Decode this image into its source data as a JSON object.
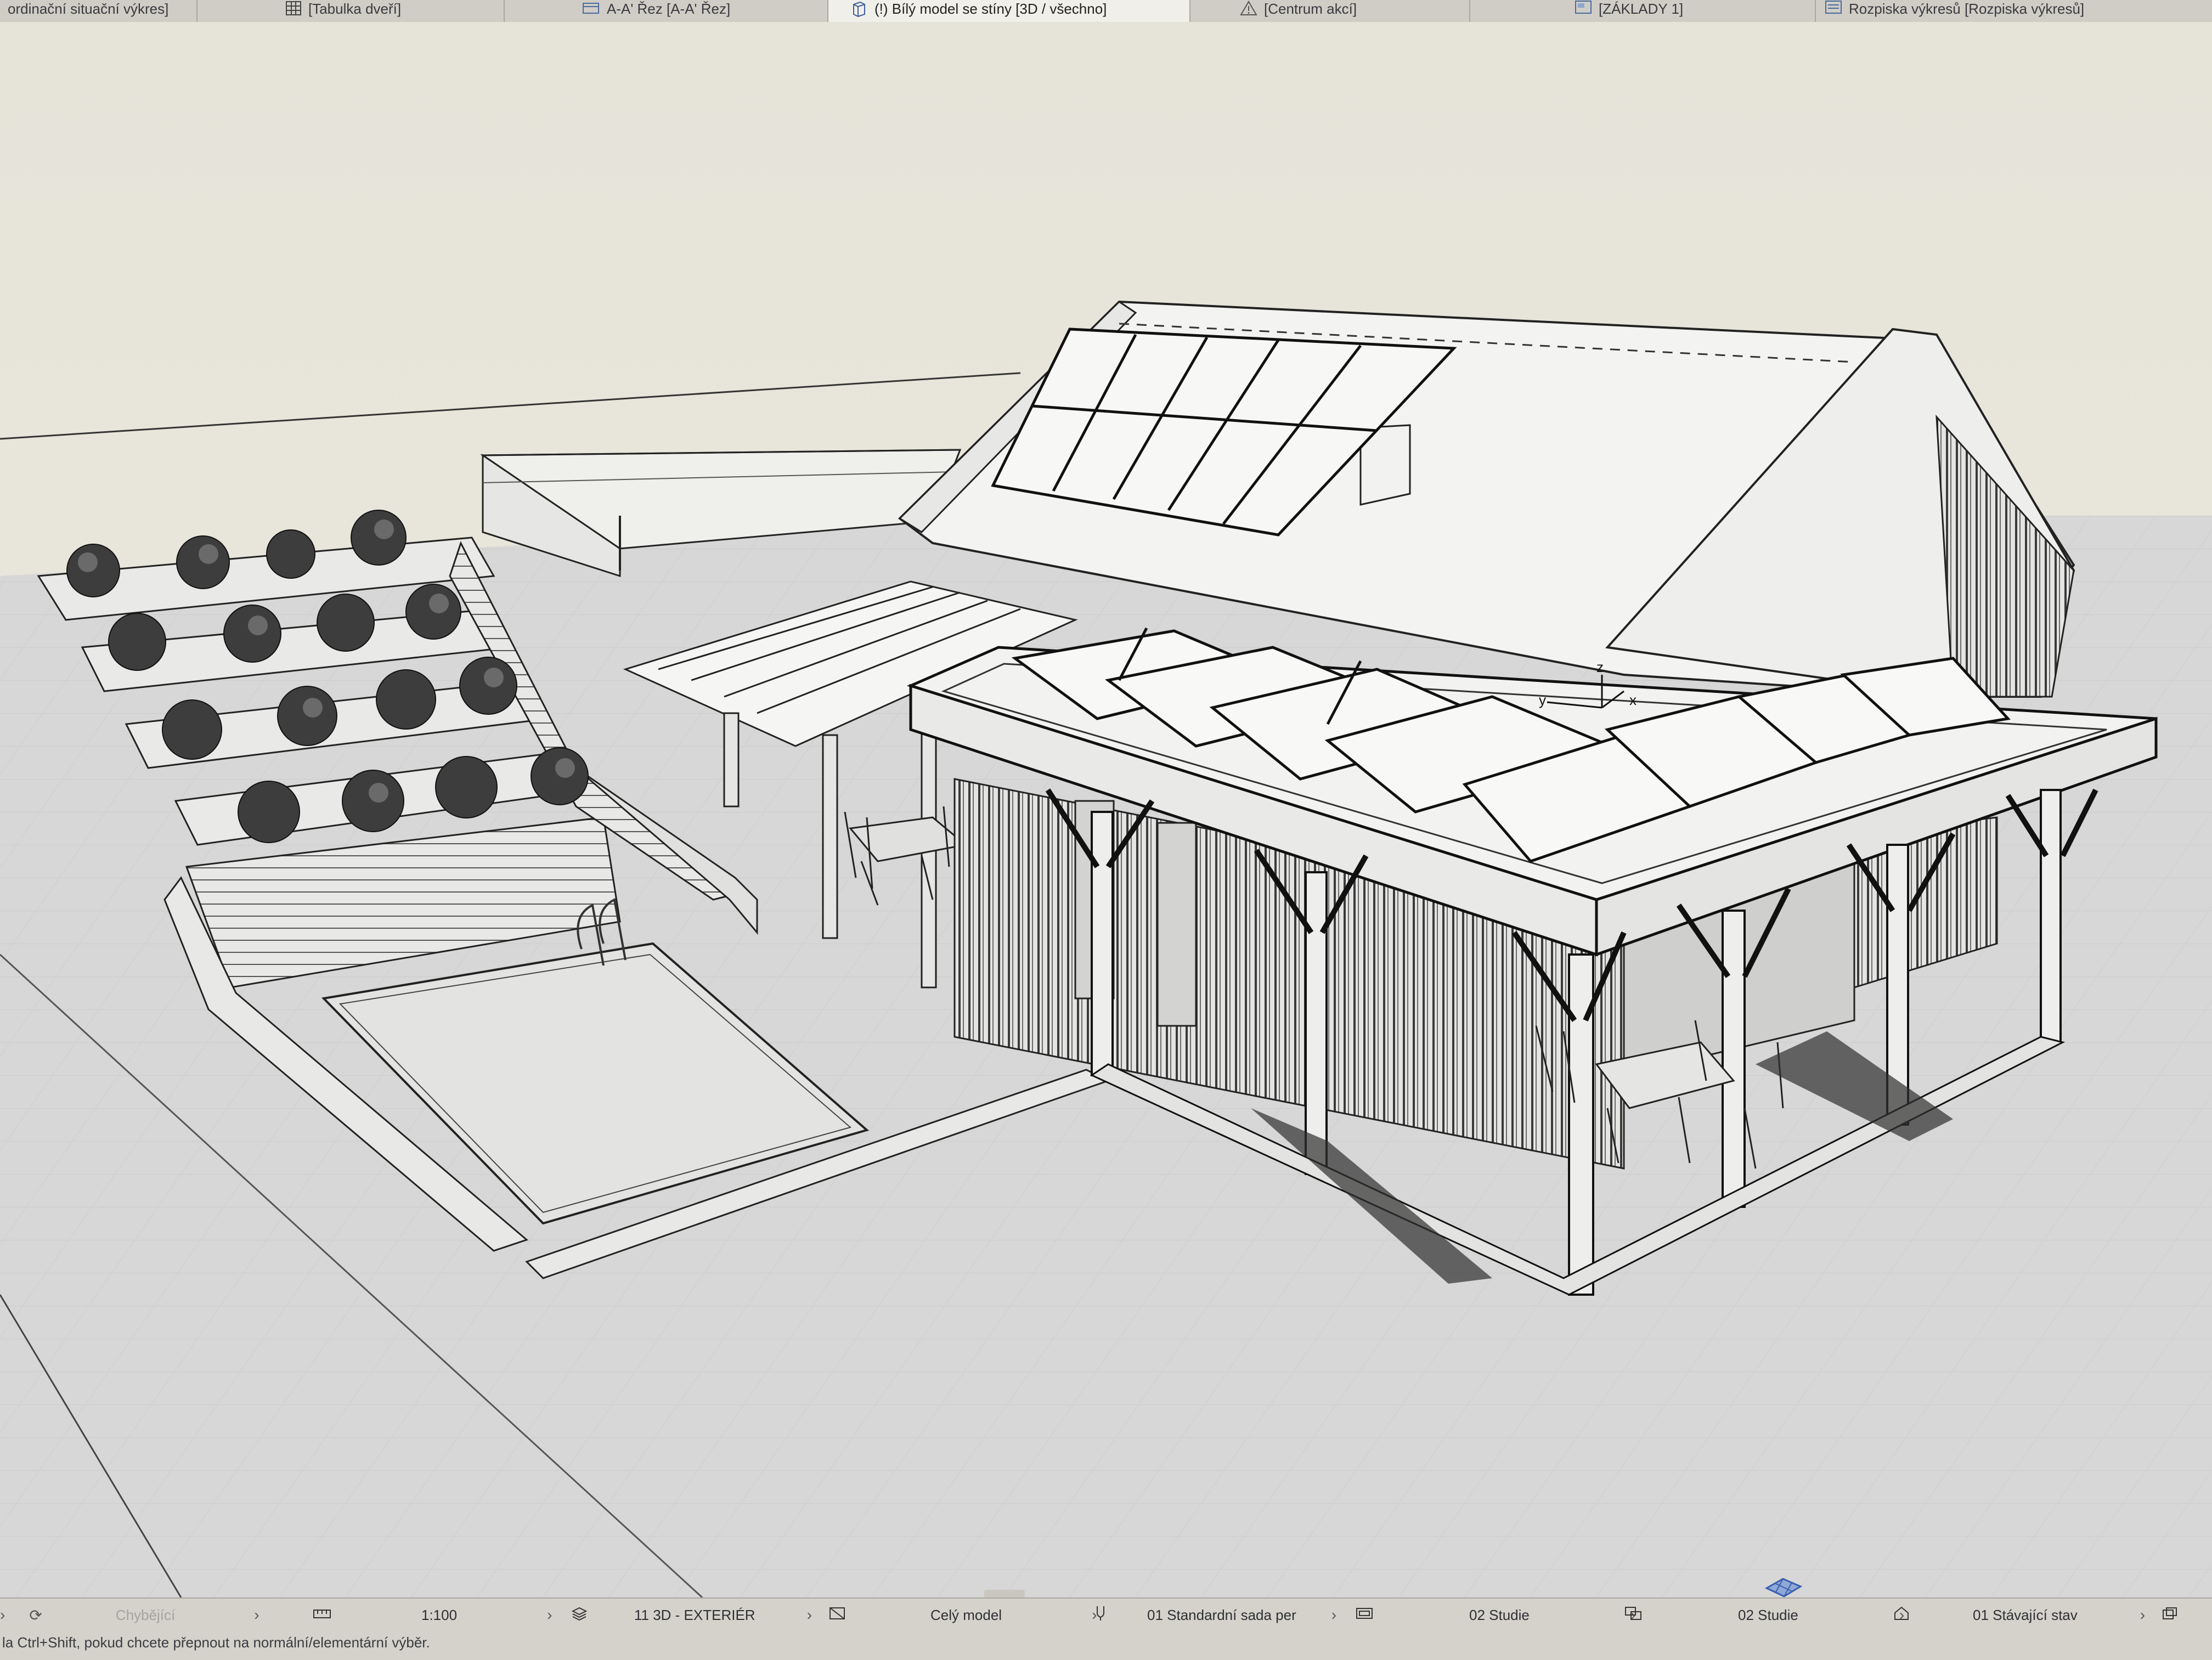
{
  "tabs": [
    {
      "label": "ordinační situační výkres]",
      "active": false,
      "icon": "document-icon"
    },
    {
      "label": "[Tabulka dveří]",
      "active": false,
      "icon": "table-icon"
    },
    {
      "label": "A-A' Řez [A-A' Řez]",
      "active": false,
      "icon": "section-icon"
    },
    {
      "label": "(!) Bílý model se stíny [3D / všechno]",
      "active": true,
      "icon": "cube-icon"
    },
    {
      "label": "[Centrum akcí]",
      "active": false,
      "icon": "warning-icon"
    },
    {
      "label": "[ZÁKLADY 1]",
      "active": false,
      "icon": "layout-icon"
    },
    {
      "label": "Rozpiska výkresů [Rozpiska výkresů]",
      "active": false,
      "icon": "list-icon"
    }
  ],
  "viewport": {
    "name": "3D model view",
    "axis_labels": {
      "x": "x",
      "y": "y",
      "z": "z"
    }
  },
  "statusbar": {
    "undo_label": "Chybějící",
    "scale": "1:100",
    "layer_combination": "11 3D - EXTERIÉR",
    "model_view": "Celý model",
    "pen_set": "01 Standardní sada per",
    "model_view_option": "02 Studie",
    "renovation_filter": "02 Studie",
    "structure_display": "01 Stávající stav",
    "hint": "la Ctrl+Shift, pokud chcete přepnout na normální/elementární výběr."
  },
  "colors": {
    "tabbar_bg": "#cfcdc5",
    "active_tab_bg": "#f0efe9",
    "viewport_sky": "#e9e7dd",
    "viewport_ground": "#d6d6d6",
    "line": "#2a2a2a",
    "statusbar_bg": "#d4d2cb"
  }
}
